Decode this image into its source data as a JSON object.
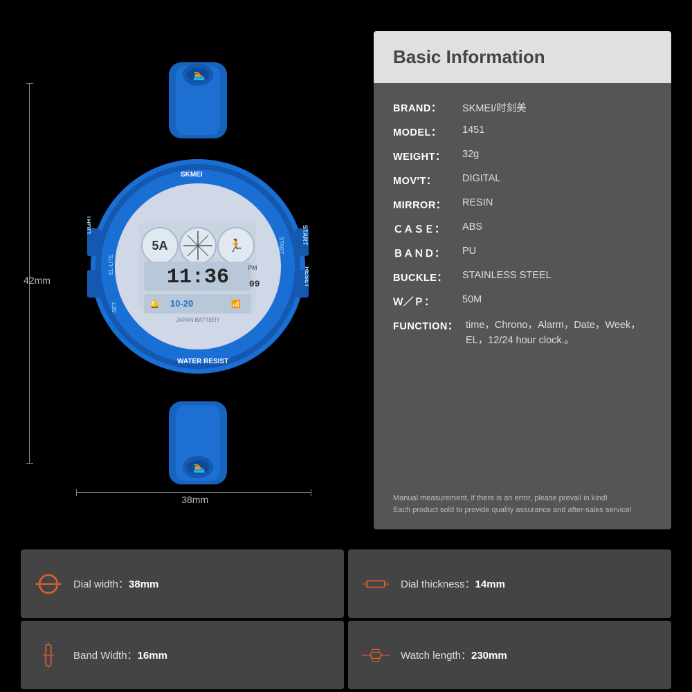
{
  "header": {
    "title": "Basic Information"
  },
  "specs": {
    "brand": {
      "label": "BRAND：",
      "value": "SKMEI/时刻美"
    },
    "model": {
      "label": "MODEL：",
      "value": "1451"
    },
    "weight": {
      "label": "WEIGHT：",
      "value": "32g"
    },
    "movt": {
      "label": "MOV'T：",
      "value": "DIGITAL"
    },
    "mirror": {
      "label": "MIRROR：",
      "value": "RESIN"
    },
    "case": {
      "label": "ＣＡＳＥ：",
      "value": "ABS"
    },
    "band": {
      "label": "ＢＡＮＤ：",
      "value": "PU"
    },
    "buckle": {
      "label": "BUCKLE：",
      "value": "STAINLESS STEEL"
    },
    "wp": {
      "label": "Ｗ／Ｐ：",
      "value": "50M"
    },
    "function": {
      "label": "FUNCTION：",
      "value": "time，Chrono，Alarm，Date，Week，EL，12/24 hour clock.。"
    }
  },
  "note": {
    "line1": "Manual measurement, if there is an error, please prevail in kind!",
    "line2": "Each product sold to provide quality assurance and after-sales service!"
  },
  "dimensions": {
    "height": "42mm",
    "width": "38mm"
  },
  "bottom_specs": [
    {
      "icon": "dial-width-icon",
      "label": "Dial width：",
      "value": "38mm"
    },
    {
      "icon": "dial-thickness-icon",
      "label": "Dial thickness：",
      "value": "14mm"
    },
    {
      "icon": "band-width-icon",
      "label": "Band Width：",
      "value": "16mm"
    },
    {
      "icon": "watch-length-icon",
      "label": "Watch length：",
      "value": "230mm"
    }
  ]
}
